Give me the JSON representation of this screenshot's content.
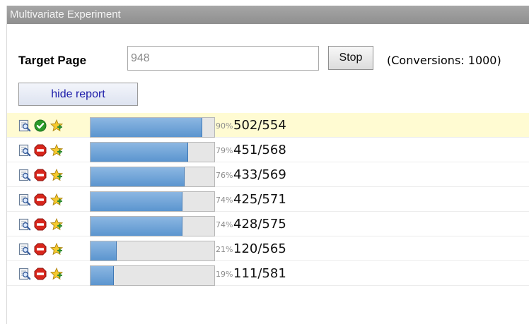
{
  "window": {
    "title": "Multivariate Experiment"
  },
  "controls": {
    "target_label": "Target Page",
    "target_value": "948",
    "stop_label": "Stop",
    "conversions_text": "(Conversions: 1000)",
    "hide_report_label": "hide report"
  },
  "colors": {
    "bar_fill": "#5b95cf",
    "highlight_row": "#fffbd2",
    "status_ok": "#2a9a2a",
    "status_stop": "#d8261c"
  },
  "variants": [
    {
      "status": "ok",
      "status_icon": "check-icon",
      "percent": "90%",
      "progress": 0.9,
      "ratio": "502/554",
      "highlight": true
    },
    {
      "status": "stop",
      "status_icon": "stop-icon",
      "percent": "79%",
      "progress": 0.79,
      "ratio": "451/568",
      "highlight": false
    },
    {
      "status": "stop",
      "status_icon": "stop-icon",
      "percent": "76%",
      "progress": 0.76,
      "ratio": "433/569",
      "highlight": false
    },
    {
      "status": "stop",
      "status_icon": "stop-icon",
      "percent": "74%",
      "progress": 0.74,
      "ratio": "425/571",
      "highlight": false
    },
    {
      "status": "stop",
      "status_icon": "stop-icon",
      "percent": "74%",
      "progress": 0.74,
      "ratio": "428/575",
      "highlight": false
    },
    {
      "status": "stop",
      "status_icon": "stop-icon",
      "percent": "21%",
      "progress": 0.21,
      "ratio": "120/565",
      "highlight": false
    },
    {
      "status": "stop",
      "status_icon": "stop-icon",
      "percent": "19%",
      "progress": 0.19,
      "ratio": "111/581",
      "highlight": false
    }
  ]
}
